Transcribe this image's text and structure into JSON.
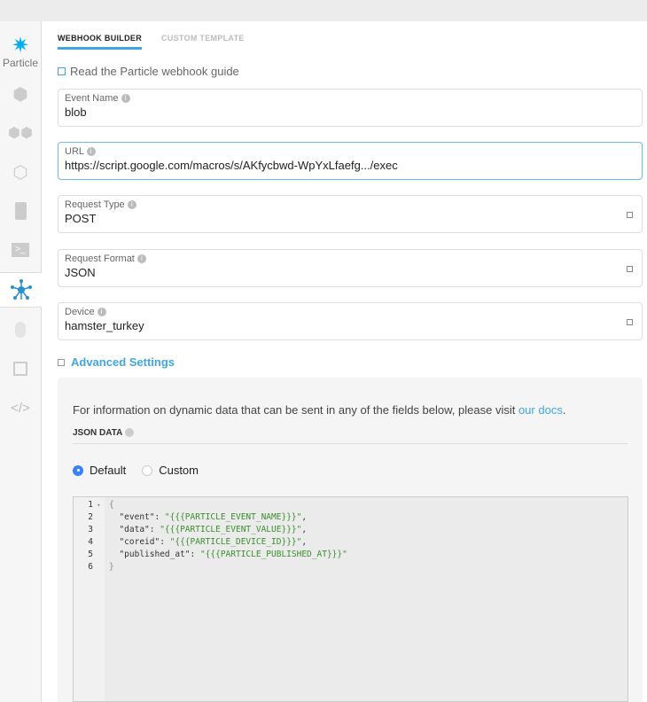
{
  "sidebar": {
    "logo_text": "Particle",
    "items": [
      "devices",
      "products",
      "mesh",
      "sim-cards",
      "console",
      "integrations",
      "authentication",
      "events",
      "ide"
    ]
  },
  "tabs": [
    {
      "label": "WEBHOOK BUILDER",
      "active": true
    },
    {
      "label": "CUSTOM TEMPLATE",
      "active": false
    }
  ],
  "guide_link": "Read the Particle webhook guide",
  "fields": [
    {
      "label": "Event Name",
      "value": "blob"
    },
    {
      "label": "URL",
      "value": "https://script.google.com/macros/s/AKfycbwd-WpYxLfaefg.../exec"
    },
    {
      "label": "Request Type",
      "value": "POST"
    },
    {
      "label": "Request Format",
      "value": "JSON"
    },
    {
      "label": "Device",
      "value": "hamster_turkey"
    }
  ],
  "advanced": {
    "label": "Advanced Settings",
    "info_text": "For information on dynamic data that can be sent in any of the fields below, please visit ",
    "docs_link": "our docs",
    "info_end": ".",
    "json_header": "JSON DATA",
    "radio_default": "Default",
    "radio_custom": "Custom",
    "selected": "Default"
  },
  "editor": {
    "lines": [
      {
        "n": "1",
        "code": "{"
      },
      {
        "n": "2",
        "key": "  \"event\": ",
        "val": "\"{{{PARTICLE_EVENT_NAME}}}\"",
        "end": ","
      },
      {
        "n": "3",
        "key": "  \"data\": ",
        "val": "\"{{{PARTICLE_EVENT_VALUE}}}\"",
        "end": ","
      },
      {
        "n": "4",
        "key": "  \"coreid\": ",
        "val": "\"{{{PARTICLE_DEVICE_ID}}}\"",
        "end": ","
      },
      {
        "n": "5",
        "key": "  \"published_at\": ",
        "val": "\"{{{PARTICLE_PUBLISHED_AT}}}\"",
        "end": ""
      },
      {
        "n": "6",
        "code": "}"
      }
    ]
  }
}
